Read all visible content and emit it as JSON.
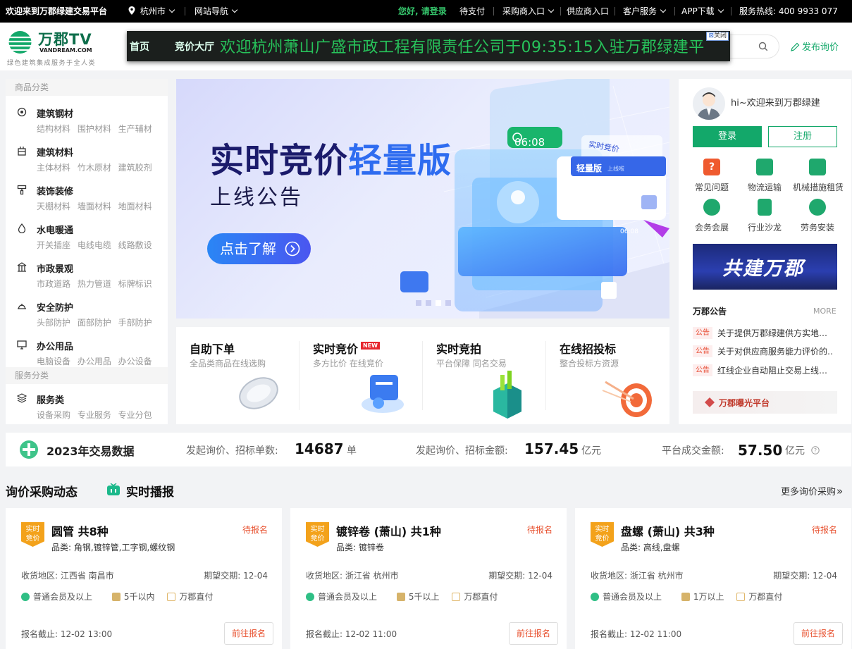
{
  "topbar": {
    "welcome": "欢迎来到万郡绿建交易平台",
    "city": "杭州市",
    "site_nav": "网站导航",
    "greeting": "您好, 请登录",
    "pending_pay": "待支付",
    "buyer_entry": "采购商入口",
    "supplier_entry": "供应商入口",
    "customer_service": "客户服务",
    "app_download": "APP下载",
    "hotline": "服务热线: 400 9933 077"
  },
  "header": {
    "logo_title": "万郡TV",
    "logo_sub": "VANDREAM.COM",
    "logo_slogan": "绿色建筑集成服务于全人类",
    "publish_inquiry": "发布询价",
    "nav_items": [
      "首页",
      "竞价大厅"
    ],
    "marquee": "欢迎杭州萧山广盛市政工程有限责任公司于09:35:15入驻万郡绿建平",
    "ad_close": "关闭"
  },
  "sidebar": {
    "goods_title": "商品分类",
    "service_title": "服务分类",
    "categories": [
      {
        "name": "建筑钢材",
        "subs": "结构材料 围护材料 生产辅材",
        "icon": "steel-icon"
      },
      {
        "name": "建筑材料",
        "subs": "主体材料 竹木原材 建筑胶剂",
        "icon": "building-material-icon"
      },
      {
        "name": "装饰装修",
        "subs": "天棚材料 墙面材料 地面材料",
        "icon": "paint-roller-icon"
      },
      {
        "name": "水电暖通",
        "subs": "开关插座 电线电缆 线路敷设",
        "icon": "water-drop-icon"
      },
      {
        "name": "市政景观",
        "subs": "市政道路 热力管道 标牌标识",
        "icon": "municipal-icon"
      },
      {
        "name": "安全防护",
        "subs": "头部防护 面部防护 手部防护",
        "icon": "helmet-icon"
      },
      {
        "name": "办公用品",
        "subs": "电脑设备 办公用品 办公设备",
        "icon": "monitor-icon"
      }
    ],
    "service": {
      "name": "服务类",
      "subs": "设备采购 专业服务 专业分包",
      "icon": "layers-icon"
    }
  },
  "banner": {
    "headline_a": "实时竞价",
    "headline_b": "轻量版",
    "subline": "上线公告",
    "cta": "点击了解",
    "timer": "06:08",
    "panel_title": "实时竞价",
    "panel_sub": "轻量版",
    "panel_small": "上线啦",
    "timer_small": "06:08"
  },
  "services": [
    {
      "title": "自助下单",
      "desc": "全品类商品在线选购",
      "new": ""
    },
    {
      "title": "实时竞价",
      "desc": "多方比价 在线竞价",
      "new": "NEW"
    },
    {
      "title": "实时竞拍",
      "desc": "平台保障 同名交易",
      "new": ""
    },
    {
      "title": "在线招投标",
      "desc": "整合投标方资源",
      "new": ""
    }
  ],
  "right": {
    "welcome": "hi~欢迎来到万郡绿建",
    "login": "登录",
    "register": "注册",
    "quick": [
      "常见问题",
      "物流运输",
      "机械措施租赁",
      "会务会展",
      "行业沙龙",
      "劳务安装"
    ],
    "promo_text": "共建万郡",
    "notice_title": "万郡公告",
    "more": "MORE",
    "notice_tag": "公告",
    "notices": [
      "关于提供万郡绿建供方实地…",
      "关于对供应商服务能力评价的…",
      "红线企业自动阻止交易上线…"
    ],
    "exposure": "万郡曝光平台"
  },
  "stats": {
    "title": "2023年交易数据",
    "label1": "发起询价、招标单数:",
    "value1": "14687",
    "unit1": "单",
    "label2": "发起询价、招标金额:",
    "value2": "157.45",
    "unit2": "亿元",
    "label3": "平台成交金额:",
    "value3": "57.50",
    "unit3": "亿元"
  },
  "section": {
    "tab1": "询价采购动态",
    "tab2": "实时播报",
    "more": "更多询价采购"
  },
  "cards": [
    {
      "badge1": "实时",
      "badge2": "竞价",
      "title": "圆管 共8种",
      "status": "待报名",
      "category": "品类: 角钢,镀锌管,工字钢,螺纹钢",
      "region": "收货地区: 江西省 南昌市",
      "due": "期望交期: 12-04",
      "member": "普通会员及以上",
      "amount": "5千以内",
      "direct": "万郡直付",
      "deadline": "报名截止: 12-02 13:00",
      "button": "前往报名"
    },
    {
      "badge1": "实时",
      "badge2": "竞价",
      "title": "镀锌卷 (萧山) 共1种",
      "status": "待报名",
      "category": "品类: 镀锌卷",
      "region": "收货地区: 浙江省 杭州市",
      "due": "期望交期: 12-04",
      "member": "普通会员及以上",
      "amount": "5千以上",
      "direct": "万郡直付",
      "deadline": "报名截止: 12-02 11:00",
      "button": "前往报名"
    },
    {
      "badge1": "实时",
      "badge2": "竞价",
      "title": "盘螺 (萧山) 共3种",
      "status": "待报名",
      "category": "品类: 高线,盘螺",
      "region": "收货地区: 浙江省 杭州市",
      "due": "期望交期: 12-04",
      "member": "普通会员及以上",
      "amount": "1万以上",
      "direct": "万郡直付",
      "deadline": "报名截止: 12-02 11:00",
      "button": "前往报名"
    }
  ],
  "colors": {
    "brand_green": "#13a86a",
    "accent_red": "#e8512f",
    "badge_orange": "#f3a21b",
    "topbar_bg": "#000000"
  }
}
